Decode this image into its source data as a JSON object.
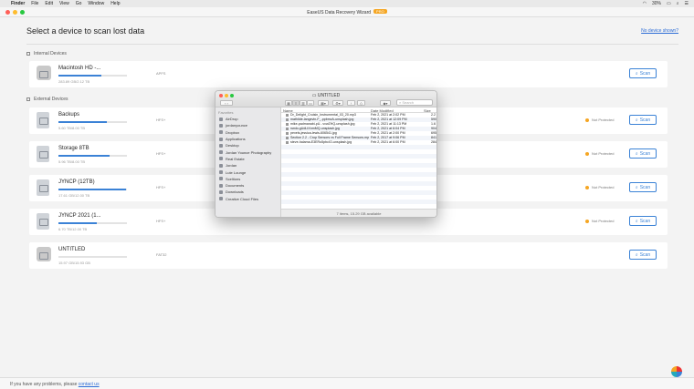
{
  "menubar": {
    "apple": "",
    "items": [
      "Finder",
      "File",
      "Edit",
      "View",
      "Go",
      "Window",
      "Help"
    ],
    "battery": "30%",
    "clock": ""
  },
  "window": {
    "title": "EaseUS Data Recovery Wizard",
    "badge": "PRO"
  },
  "page": {
    "heading": "Select a device to scan lost data",
    "no_device_link": "No device shown?"
  },
  "internal": {
    "label": "Internal Devices",
    "devices": [
      {
        "name": "Macintosh HD -...",
        "size": "283.89 GB/2.12 TB",
        "fs": "APFS",
        "usage": 0.62,
        "protect": "",
        "scan": "Scan"
      }
    ]
  },
  "external": {
    "label": "External Devices",
    "devices": [
      {
        "name": "Backups",
        "size": "5.60 TB/8.00 TB",
        "fs": "HFS+",
        "usage": 0.7,
        "protect": "Not Protected",
        "scan": "Scan"
      },
      {
        "name": "Storage 8TB",
        "size": "5.96 TB/8.00 TB",
        "fs": "HFS+",
        "usage": 0.74,
        "protect": "Not Protected",
        "scan": "Scan"
      },
      {
        "name": "JYNCP (12TB)",
        "size": "17.61 GB/12.00 TB",
        "fs": "HFS+",
        "usage": 0.99,
        "protect": "Not Protected",
        "scan": "Scan"
      },
      {
        "name": "JYNCP 2021 (1...",
        "size": "6.70 TB/12.00 TB",
        "fs": "HFS+",
        "usage": 0.56,
        "protect": "Not Protected",
        "scan": "Scan"
      },
      {
        "name": "UNTITLED",
        "size": "15.97 GB/15.93 GB",
        "fs": "FAT32",
        "usage": 0.0,
        "protect": "",
        "scan": "Scan"
      }
    ]
  },
  "footer": {
    "text": "If you have any problems, please",
    "link": "contact us"
  },
  "finder": {
    "title": "UNTITLED",
    "search_placeholder": "Search",
    "sidebar_header": "Favorites",
    "sidebar": [
      "AirDrop",
      "jordanyounce",
      "Dropbox",
      "Applications",
      "Desktop",
      "Jordan Younce Photography",
      "Real Estate",
      "Jordan",
      "Lute Lounge",
      "Sceltions",
      "Documents",
      "Downloads",
      "Creative Cloud Files"
    ],
    "columns": {
      "name": "Name",
      "date": "Date Modified",
      "size": "Size"
    },
    "files": [
      {
        "name": "Dr_Delight_Cruisin_Instrumental_03_20.mp3",
        "date": "Feb 2, 2021 at 2:02 PM",
        "size": "2.2"
      },
      {
        "name": "mathilde-langevin-F_-ppbmvA-unsplash.jpg",
        "date": "Feb 2, 2021 at 12:09 PM",
        "size": "590"
      },
      {
        "name": "mike-padmanabi-pU...vvwZHQ-unsplash.jpg",
        "date": "Feb 2, 2021 at 11:13 PM",
        "size": "1.6"
      },
      {
        "name": "nwdo-gUdLtXnmMQ-unsplash.jpg",
        "date": "Feb 2, 2021 at 6:04 PM",
        "size": "904"
      },
      {
        "name": "pexels-jessica-lewis-606541.jpg",
        "date": "Feb 2, 2021 at 2:00 PM",
        "size": "695"
      },
      {
        "name": "Section 2.2 - Crop Sensors vs Full Frame Sensors.mp4",
        "date": "Feb 2, 2017 at 9:06 PM",
        "size": "841"
      },
      {
        "name": "steve-halama-E3ERo5pbcIO-unsplash.jpg",
        "date": "Feb 2, 2021 at 6:00 PM",
        "size": "284"
      }
    ],
    "status": "7 items, 15.29 GB available"
  }
}
